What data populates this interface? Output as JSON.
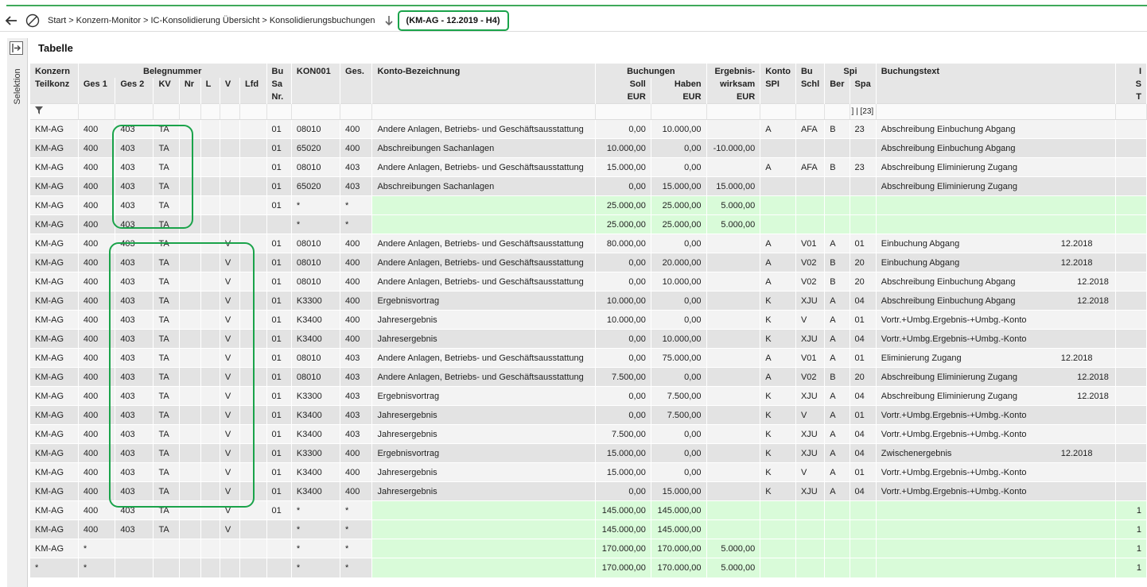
{
  "breadcrumb": {
    "items": [
      "Start",
      "Konzern-Monitor",
      "IC-Konsolidierung Übersicht",
      "Konsolidierungsbuchungen"
    ],
    "separator": ">",
    "context": "(KM-AG - 12.2019 - H4)"
  },
  "sidebar": {
    "label": "Selektion"
  },
  "panel": {
    "title": "Tabelle"
  },
  "table": {
    "group_headers": {
      "konzern": "Konzern",
      "belegnummer": "Belegnummer",
      "bu": "Bu",
      "kon001": "KON001",
      "ges": "Ges.",
      "konto_bez": "Konto-Bezeichnung",
      "buchungen": "Buchungen",
      "ergebnis": "Ergebnis-",
      "konto": "Konto",
      "bu2": "Bu",
      "spi": "Spi",
      "buchungstext": "Buchungstext",
      "overflow": "I"
    },
    "sub_headers": {
      "teilkonz": "Teilkonz",
      "ges1": "Ges 1",
      "ges2": "Ges 2",
      "kv": "KV",
      "nr": "Nr",
      "l": "L",
      "v": "V",
      "lfd": "Lfd",
      "sa": "Sa",
      "soll": "Soll",
      "haben": "Haben",
      "wirksam": "wirksam",
      "spi": "SPI",
      "schl": "Schl",
      "ber": "Ber",
      "spa": "Spa",
      "overflow": "S"
    },
    "sub_headers_2": {
      "nr": "Nr.",
      "eur1": "EUR",
      "eur2": "EUR",
      "eur3": "EUR",
      "overflow": "T"
    },
    "filter": {
      "spa": "] | [23]"
    },
    "rows": [
      {
        "k": "KM-AG",
        "g1": "400",
        "g2": "403",
        "kv": "TA",
        "nr": "",
        "l": "",
        "v": "",
        "lfd": "",
        "bu": "01",
        "kon": "08010",
        "ges": "400",
        "bez": "Andere Anlagen, Betriebs- und Geschäftsausstattung",
        "soll": "0,00",
        "haben": "10.000,00",
        "erg": "",
        "ks": "A",
        "bs": "AFA",
        "ber": "B",
        "spa": "23",
        "text": "Abschreibung Einbuchung Abgang",
        "per": "",
        "ov": "",
        "sum": false
      },
      {
        "k": "KM-AG",
        "g1": "400",
        "g2": "403",
        "kv": "TA",
        "nr": "",
        "l": "",
        "v": "",
        "lfd": "",
        "bu": "01",
        "kon": "65020",
        "ges": "400",
        "bez": "Abschreibungen Sachanlagen",
        "soll": "10.000,00",
        "haben": "0,00",
        "erg": "-10.000,00",
        "ks": "",
        "bs": "",
        "ber": "",
        "spa": "",
        "text": "Abschreibung Einbuchung Abgang",
        "per": "",
        "ov": "",
        "sum": false
      },
      {
        "k": "KM-AG",
        "g1": "400",
        "g2": "403",
        "kv": "TA",
        "nr": "",
        "l": "",
        "v": "",
        "lfd": "",
        "bu": "01",
        "kon": "08010",
        "ges": "403",
        "bez": "Andere Anlagen, Betriebs- und Geschäftsausstattung",
        "soll": "15.000,00",
        "haben": "0,00",
        "erg": "",
        "ks": "A",
        "bs": "AFA",
        "ber": "B",
        "spa": "23",
        "text": "Abschreibung Eliminierung Zugang",
        "per": "",
        "ov": "",
        "sum": false
      },
      {
        "k": "KM-AG",
        "g1": "400",
        "g2": "403",
        "kv": "TA",
        "nr": "",
        "l": "",
        "v": "",
        "lfd": "",
        "bu": "01",
        "kon": "65020",
        "ges": "403",
        "bez": "Abschreibungen Sachanlagen",
        "soll": "0,00",
        "haben": "15.000,00",
        "erg": "15.000,00",
        "ks": "",
        "bs": "",
        "ber": "",
        "spa": "",
        "text": "Abschreibung Eliminierung Zugang",
        "per": "",
        "ov": "",
        "sum": false
      },
      {
        "k": "KM-AG",
        "g1": "400",
        "g2": "403",
        "kv": "TA",
        "nr": "",
        "l": "",
        "v": "",
        "lfd": "",
        "bu": "01",
        "kon": "*",
        "ges": "*",
        "bez": "",
        "soll": "25.000,00",
        "haben": "25.000,00",
        "erg": "5.000,00",
        "ks": "",
        "bs": "",
        "ber": "",
        "spa": "",
        "text": "",
        "per": "",
        "ov": "",
        "sum": true
      },
      {
        "k": "KM-AG",
        "g1": "400",
        "g2": "403",
        "kv": "TA",
        "nr": "",
        "l": "",
        "v": "",
        "lfd": "",
        "bu": "",
        "kon": "*",
        "ges": "*",
        "bez": "",
        "soll": "25.000,00",
        "haben": "25.000,00",
        "erg": "5.000,00",
        "ks": "",
        "bs": "",
        "ber": "",
        "spa": "",
        "text": "",
        "per": "",
        "ov": "",
        "sum": true
      },
      {
        "k": "KM-AG",
        "g1": "400",
        "g2": "403",
        "kv": "TA",
        "nr": "",
        "l": "",
        "v": "V",
        "lfd": "",
        "bu": "01",
        "kon": "08010",
        "ges": "400",
        "bez": "Andere Anlagen, Betriebs- und Geschäftsausstattung",
        "soll": "80.000,00",
        "haben": "0,00",
        "erg": "",
        "ks": "A",
        "bs": "V01",
        "ber": "A",
        "spa": "01",
        "text": "Einbuchung Abgang",
        "per": "12.2018",
        "ov": "",
        "sum": false
      },
      {
        "k": "KM-AG",
        "g1": "400",
        "g2": "403",
        "kv": "TA",
        "nr": "",
        "l": "",
        "v": "V",
        "lfd": "",
        "bu": "01",
        "kon": "08010",
        "ges": "400",
        "bez": "Andere Anlagen, Betriebs- und Geschäftsausstattung",
        "soll": "0,00",
        "haben": "20.000,00",
        "erg": "",
        "ks": "A",
        "bs": "V02",
        "ber": "B",
        "spa": "20",
        "text": "Einbuchung Abgang",
        "per": "12.2018",
        "ov": "",
        "sum": false
      },
      {
        "k": "KM-AG",
        "g1": "400",
        "g2": "403",
        "kv": "TA",
        "nr": "",
        "l": "",
        "v": "V",
        "lfd": "",
        "bu": "01",
        "kon": "08010",
        "ges": "400",
        "bez": "Andere Anlagen, Betriebs- und Geschäftsausstattung",
        "soll": "0,00",
        "haben": "10.000,00",
        "erg": "",
        "ks": "A",
        "bs": "V02",
        "ber": "B",
        "spa": "20",
        "text": "Abschreibung Einbuchung Abgang",
        "per": "12.2018",
        "ov": "",
        "sum": false,
        "perright": true
      },
      {
        "k": "KM-AG",
        "g1": "400",
        "g2": "403",
        "kv": "TA",
        "nr": "",
        "l": "",
        "v": "V",
        "lfd": "",
        "bu": "01",
        "kon": "K3300",
        "ges": "400",
        "bez": "Ergebnisvortrag",
        "soll": "10.000,00",
        "haben": "0,00",
        "erg": "",
        "ks": "K",
        "bs": "XJU",
        "ber": "A",
        "spa": "04",
        "text": "Abschreibung Einbuchung Abgang",
        "per": "12.2018",
        "ov": "",
        "sum": false,
        "perright": true
      },
      {
        "k": "KM-AG",
        "g1": "400",
        "g2": "403",
        "kv": "TA",
        "nr": "",
        "l": "",
        "v": "V",
        "lfd": "",
        "bu": "01",
        "kon": "K3400",
        "ges": "400",
        "bez": "Jahresergebnis",
        "soll": "10.000,00",
        "haben": "0,00",
        "erg": "",
        "ks": "K",
        "bs": "V",
        "ber": "A",
        "spa": "01",
        "text": "Vortr.+Umbg.Ergebnis-+Umbg.-Konto",
        "per": "",
        "ov": "",
        "sum": false
      },
      {
        "k": "KM-AG",
        "g1": "400",
        "g2": "403",
        "kv": "TA",
        "nr": "",
        "l": "",
        "v": "V",
        "lfd": "",
        "bu": "01",
        "kon": "K3400",
        "ges": "400",
        "bez": "Jahresergebnis",
        "soll": "0,00",
        "haben": "10.000,00",
        "erg": "",
        "ks": "K",
        "bs": "XJU",
        "ber": "A",
        "spa": "04",
        "text": "Vortr.+Umbg.Ergebnis-+Umbg.-Konto",
        "per": "",
        "ov": "",
        "sum": false
      },
      {
        "k": "KM-AG",
        "g1": "400",
        "g2": "403",
        "kv": "TA",
        "nr": "",
        "l": "",
        "v": "V",
        "lfd": "",
        "bu": "01",
        "kon": "08010",
        "ges": "403",
        "bez": "Andere Anlagen, Betriebs- und Geschäftsausstattung",
        "soll": "0,00",
        "haben": "75.000,00",
        "erg": "",
        "ks": "A",
        "bs": "V01",
        "ber": "A",
        "spa": "01",
        "text": "Eliminierung Zugang",
        "per": "12.2018",
        "ov": "",
        "sum": false
      },
      {
        "k": "KM-AG",
        "g1": "400",
        "g2": "403",
        "kv": "TA",
        "nr": "",
        "l": "",
        "v": "V",
        "lfd": "",
        "bu": "01",
        "kon": "08010",
        "ges": "403",
        "bez": "Andere Anlagen, Betriebs- und Geschäftsausstattung",
        "soll": "7.500,00",
        "haben": "0,00",
        "erg": "",
        "ks": "A",
        "bs": "V02",
        "ber": "B",
        "spa": "20",
        "text": "Abschreibung Eliminierung Zugang",
        "per": "12.2018",
        "ov": "",
        "sum": false,
        "perright": true
      },
      {
        "k": "KM-AG",
        "g1": "400",
        "g2": "403",
        "kv": "TA",
        "nr": "",
        "l": "",
        "v": "V",
        "lfd": "",
        "bu": "01",
        "kon": "K3300",
        "ges": "403",
        "bez": "Ergebnisvortrag",
        "soll": "0,00",
        "haben": "7.500,00",
        "erg": "",
        "ks": "K",
        "bs": "XJU",
        "ber": "A",
        "spa": "04",
        "text": "Abschreibung Eliminierung Zugang",
        "per": "12.2018",
        "ov": "",
        "sum": false,
        "perright": true
      },
      {
        "k": "KM-AG",
        "g1": "400",
        "g2": "403",
        "kv": "TA",
        "nr": "",
        "l": "",
        "v": "V",
        "lfd": "",
        "bu": "01",
        "kon": "K3400",
        "ges": "403",
        "bez": "Jahresergebnis",
        "soll": "0,00",
        "haben": "7.500,00",
        "erg": "",
        "ks": "K",
        "bs": "V",
        "ber": "A",
        "spa": "01",
        "text": "Vortr.+Umbg.Ergebnis-+Umbg.-Konto",
        "per": "",
        "ov": "",
        "sum": false
      },
      {
        "k": "KM-AG",
        "g1": "400",
        "g2": "403",
        "kv": "TA",
        "nr": "",
        "l": "",
        "v": "V",
        "lfd": "",
        "bu": "01",
        "kon": "K3400",
        "ges": "403",
        "bez": "Jahresergebnis",
        "soll": "7.500,00",
        "haben": "0,00",
        "erg": "",
        "ks": "K",
        "bs": "XJU",
        "ber": "A",
        "spa": "04",
        "text": "Vortr.+Umbg.Ergebnis-+Umbg.-Konto",
        "per": "",
        "ov": "",
        "sum": false
      },
      {
        "k": "KM-AG",
        "g1": "400",
        "g2": "403",
        "kv": "TA",
        "nr": "",
        "l": "",
        "v": "V",
        "lfd": "",
        "bu": "01",
        "kon": "K3300",
        "ges": "400",
        "bez": "Ergebnisvortrag",
        "soll": "15.000,00",
        "haben": "0,00",
        "erg": "",
        "ks": "K",
        "bs": "XJU",
        "ber": "A",
        "spa": "04",
        "text": "Zwischenergebnis",
        "per": "12.2018",
        "ov": "",
        "sum": false
      },
      {
        "k": "KM-AG",
        "g1": "400",
        "g2": "403",
        "kv": "TA",
        "nr": "",
        "l": "",
        "v": "V",
        "lfd": "",
        "bu": "01",
        "kon": "K3400",
        "ges": "400",
        "bez": "Jahresergebnis",
        "soll": "15.000,00",
        "haben": "0,00",
        "erg": "",
        "ks": "K",
        "bs": "V",
        "ber": "A",
        "spa": "01",
        "text": "Vortr.+Umbg.Ergebnis-+Umbg.-Konto",
        "per": "",
        "ov": "",
        "sum": false
      },
      {
        "k": "KM-AG",
        "g1": "400",
        "g2": "403",
        "kv": "TA",
        "nr": "",
        "l": "",
        "v": "V",
        "lfd": "",
        "bu": "01",
        "kon": "K3400",
        "ges": "400",
        "bez": "Jahresergebnis",
        "soll": "0,00",
        "haben": "15.000,00",
        "erg": "",
        "ks": "K",
        "bs": "XJU",
        "ber": "A",
        "spa": "04",
        "text": "Vortr.+Umbg.Ergebnis-+Umbg.-Konto",
        "per": "",
        "ov": "",
        "sum": false
      },
      {
        "k": "KM-AG",
        "g1": "400",
        "g2": "403",
        "kv": "TA",
        "nr": "",
        "l": "",
        "v": "V",
        "lfd": "",
        "bu": "01",
        "kon": "*",
        "ges": "*",
        "bez": "",
        "soll": "145.000,00",
        "haben": "145.000,00",
        "erg": "",
        "ks": "",
        "bs": "",
        "ber": "",
        "spa": "",
        "text": "",
        "per": "",
        "ov": "1",
        "sum": true
      },
      {
        "k": "KM-AG",
        "g1": "400",
        "g2": "403",
        "kv": "TA",
        "nr": "",
        "l": "",
        "v": "V",
        "lfd": "",
        "bu": "",
        "kon": "*",
        "ges": "*",
        "bez": "",
        "soll": "145.000,00",
        "haben": "145.000,00",
        "erg": "",
        "ks": "",
        "bs": "",
        "ber": "",
        "spa": "",
        "text": "",
        "per": "",
        "ov": "1",
        "sum": true
      },
      {
        "k": "KM-AG",
        "g1": "*",
        "g2": "",
        "kv": "",
        "nr": "",
        "l": "",
        "v": "",
        "lfd": "",
        "bu": "",
        "kon": "*",
        "ges": "*",
        "bez": "",
        "soll": "170.000,00",
        "haben": "170.000,00",
        "erg": "5.000,00",
        "ks": "",
        "bs": "",
        "ber": "",
        "spa": "",
        "text": "",
        "per": "",
        "ov": "1",
        "sum": true
      },
      {
        "k": "*",
        "g1": "*",
        "g2": "",
        "kv": "",
        "nr": "",
        "l": "",
        "v": "",
        "lfd": "",
        "bu": "",
        "kon": "*",
        "ges": "*",
        "bez": "",
        "soll": "170.000,00",
        "haben": "170.000,00",
        "erg": "5.000,00",
        "ks": "",
        "bs": "",
        "ber": "",
        "spa": "",
        "text": "",
        "per": "",
        "ov": "1",
        "sum": true
      }
    ]
  },
  "colors": {
    "accent": "#1aa34a",
    "sum_row": "#d9fbd9",
    "header_bg": "#e6e6e6"
  }
}
